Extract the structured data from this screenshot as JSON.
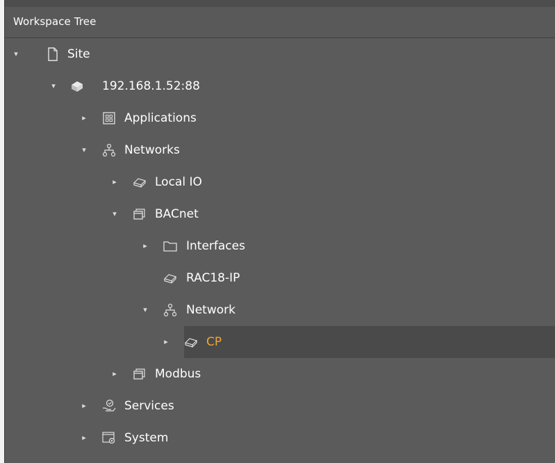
{
  "panel": {
    "title": "Workspace Tree"
  },
  "tree": {
    "site": {
      "label": "Site",
      "icon": "document-icon",
      "expanded": true
    },
    "host": {
      "label": "192.168.1.52:88",
      "icon": "server-icon",
      "expanded": true
    },
    "applications": {
      "label": "Applications",
      "icon": "applications-icon",
      "expanded": false
    },
    "networks": {
      "label": "Networks",
      "icon": "network-icon",
      "expanded": true
    },
    "local_io": {
      "label": "Local IO",
      "icon": "device-icon",
      "expanded": false
    },
    "bacnet": {
      "label": "BACnet",
      "icon": "stack-icon",
      "expanded": true
    },
    "interfaces": {
      "label": "Interfaces",
      "icon": "folder-icon",
      "expanded": false
    },
    "rac18": {
      "label": "RAC18-IP",
      "icon": "device-icon"
    },
    "network": {
      "label": "Network",
      "icon": "network-icon",
      "expanded": true
    },
    "cp": {
      "label": "CP",
      "icon": "device-icon",
      "expanded": false,
      "selected": true
    },
    "modbus": {
      "label": "Modbus",
      "icon": "stack-icon",
      "expanded": false
    },
    "services": {
      "label": "Services",
      "icon": "services-icon",
      "expanded": false
    },
    "system": {
      "label": "System",
      "icon": "system-icon",
      "expanded": false
    }
  },
  "colors": {
    "panel_bg": "#5b5b5b",
    "selected_bg": "#4a4a4a",
    "selected_text": "#f0a830",
    "text": "#ffffff"
  }
}
